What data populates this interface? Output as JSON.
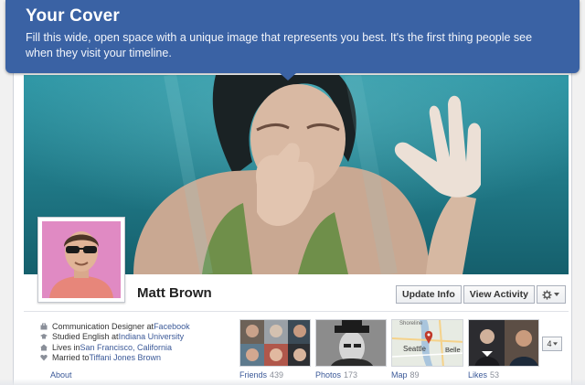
{
  "tooltip": {
    "title": "Your Cover",
    "body": "Fill this wide, open space with a unique image that represents you best. It's the first thing people see when they visit your timeline."
  },
  "profile": {
    "name": "Matt Brown"
  },
  "actions": {
    "update_info": "Update Info",
    "view_activity": "View Activity",
    "gear_icon": "gear-icon"
  },
  "about": {
    "label": "About",
    "items": [
      {
        "icon": "briefcase-icon",
        "prefix": "Communication Designer at ",
        "link": "Facebook"
      },
      {
        "icon": "graduation-icon",
        "prefix": "Studied English at ",
        "link": "Indiana University"
      },
      {
        "icon": "home-icon",
        "prefix": "Lives in ",
        "link": "San Francisco, California"
      },
      {
        "icon": "heart-icon",
        "prefix": "Married to ",
        "link": "Tiffani Jones Brown"
      }
    ]
  },
  "tabs": [
    {
      "label": "Friends",
      "count": "439"
    },
    {
      "label": "Photos",
      "count": "173"
    },
    {
      "label": "Map",
      "count": "89"
    },
    {
      "label": "Likes",
      "count": "53"
    }
  ],
  "map_labels": {
    "top": "Shoreline",
    "city1": "Seattle",
    "city2": "Belle"
  },
  "more": {
    "count": "4"
  },
  "colors": {
    "tooltip_bg": "#3a62a4",
    "link": "#3b5998",
    "profile_bg": "#e08ac3"
  }
}
